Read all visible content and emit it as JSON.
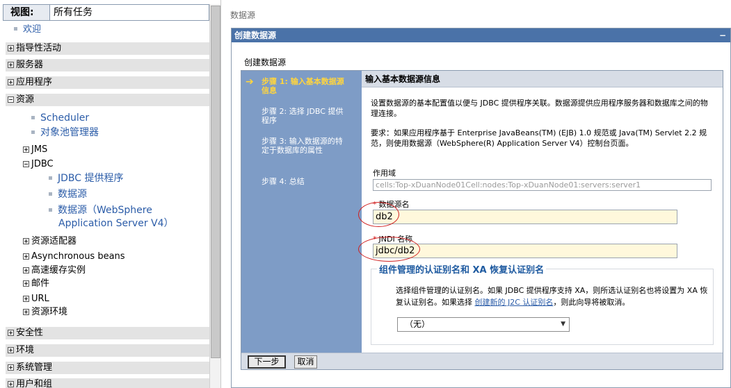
{
  "nav": {
    "view_label": "视图:",
    "view_value": "所有任务",
    "welcome": "欢迎",
    "guided": "指导性活动",
    "servers": "服务器",
    "applications": "应用程序",
    "resources": "资源",
    "scheduler": "Scheduler",
    "object_pool": "对象池管理器",
    "jms": "JMS",
    "jdbc": "JDBC",
    "jdbc_providers": "JDBC 提供程序",
    "datasources": "数据源",
    "datasources_v4_line1": "数据源（WebSphere",
    "datasources_v4_line2": "Application Server V4）",
    "resource_adapters": "资源适配器",
    "async_beans": "Asynchronous beans",
    "cache_instances": "高速缓存实例",
    "mail": "邮件",
    "url": "URL",
    "resource_env": "资源环境",
    "security": "安全性",
    "environment": "环境",
    "system_admin": "系统管理",
    "users_groups": "用户和组"
  },
  "breadcrumb": "数据源",
  "panel": {
    "title": "创建数据源",
    "collapse": "−",
    "heading": "创建数据源"
  },
  "steps": {
    "arrow": "➔",
    "step1": "步骤 1: 输入基本数据源信息",
    "step2": "步骤 2: 选择 JDBC 提供程序",
    "step3": "步骤 3: 输入数据源的特定于数据库的属性",
    "step4": "步骤 4: 总结"
  },
  "form": {
    "title": "输入基本数据源信息",
    "desc1": "设置数据源的基本配置值以便与 JDBC 提供程序关联。数据源提供应用程序服务器和数据库之间的物理连接。",
    "desc2": "要求：如果应用程序基于 Enterprise JavaBeans(TM) (EJB) 1.0 规范或 Java(TM) Servlet 2.2 规范，则使用数据源（WebSphere(R) Application Server V4）控制台页面。",
    "scope_label": "作用域",
    "scope_value": "cells:Top-xDuanNode01Cell:nodes:Top-xDuanNode01:servers:server1",
    "required_mark": "*",
    "ds_name_label": "数据源名",
    "ds_name_value": "db2",
    "jndi_label": "JNDI 名称",
    "jndi_value": "jdbc/db2",
    "alias_legend": "组件管理的认证别名和 XA 恢复认证别名",
    "alias_desc_before": "选择组件管理的认证别名。如果 JDBC 提供程序支持 XA，则所选认证别名也将设置为 XA 恢复认证别名。如果选择 ",
    "alias_link": "创建新的 J2C 认证别名",
    "alias_desc_after": "，则此向导将被取消。",
    "alias_selected": "（无）"
  },
  "buttons": {
    "next": "下一步",
    "cancel": "取消"
  },
  "colors": {
    "panel_header": "#4a72a8",
    "steps_bg": "#7e9cc6",
    "current_step": "#ffd53e",
    "input_bg": "#fff8dc",
    "annotation": "#d02020",
    "link": "#2b5ca8"
  }
}
